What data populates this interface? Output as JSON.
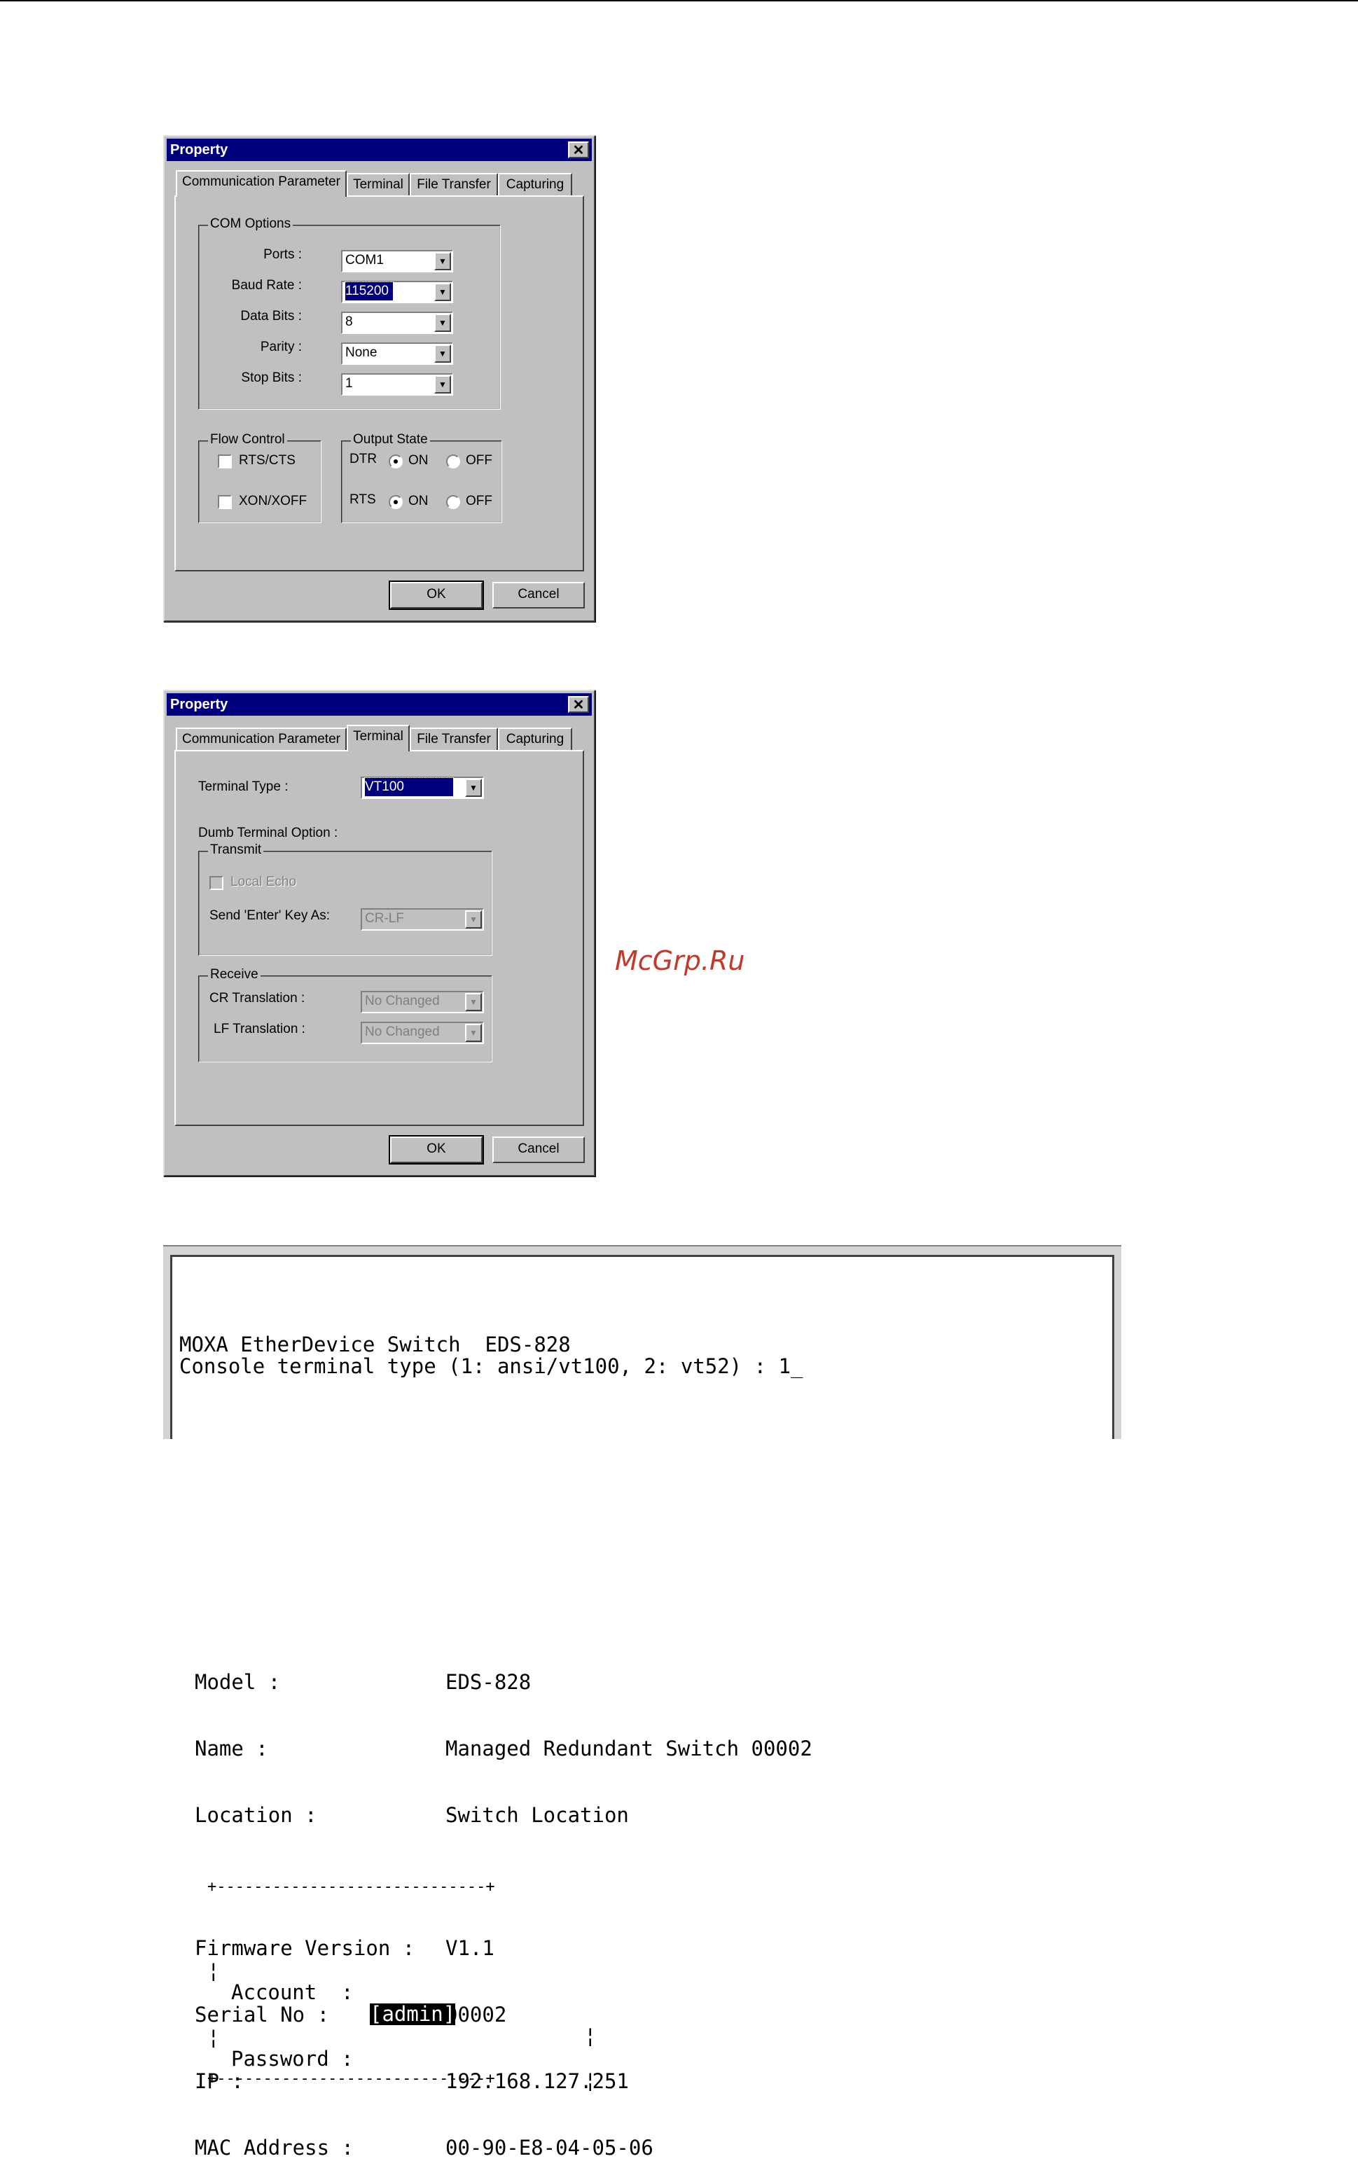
{
  "dialog1": {
    "title": "Property",
    "close_glyph": "✕",
    "tabs": [
      "Communication Parameter",
      "Terminal",
      "File Transfer",
      "Capturing"
    ],
    "com_options": {
      "label": "COM Options",
      "ports_label": "Ports :",
      "ports_value": "COM1",
      "baud_label": "Baud Rate :",
      "baud_value": "115200",
      "databits_label": "Data Bits :",
      "databits_value": "8",
      "parity_label": "Parity :",
      "parity_value": "None",
      "stopbits_label": "Stop Bits :",
      "stopbits_value": "1"
    },
    "flow_control": {
      "label": "Flow Control",
      "rts_cts": "RTS/CTS",
      "xon_xoff": "XON/XOFF"
    },
    "output_state": {
      "label": "Output State",
      "dtr": "DTR",
      "rts": "RTS",
      "on": "ON",
      "off": "OFF"
    },
    "ok": "OK",
    "cancel": "Cancel"
  },
  "dialog2": {
    "title": "Property",
    "close_glyph": "✕",
    "tabs": [
      "Communication Parameter",
      "Terminal",
      "File Transfer",
      "Capturing"
    ],
    "terminal_type_label": "Terminal Type :",
    "terminal_type_value": "VT100",
    "dumb_option_label": "Dumb Terminal Option :",
    "transmit_label": "Transmit",
    "local_echo": "Local Echo",
    "send_enter_label": "Send 'Enter' Key As:",
    "send_enter_value": "CR-LF",
    "receive_label": "Receive",
    "cr_label": "CR Translation :",
    "cr_value": "No Changed",
    "lf_label": "LF Translation :",
    "lf_value": "No Changed",
    "ok": "OK",
    "cancel": "Cancel"
  },
  "watermark": "McGrp.Ru",
  "terminal": {
    "line1": "MOXA EtherDevice Switch  EDS-828",
    "line2": "Console terminal type (1: ansi/vt100, 2: vt52) : 1_"
  },
  "info": [
    {
      "key": "Model :",
      "value": "EDS-828"
    },
    {
      "key": "Name :",
      "value": "Managed Redundant Switch 00002"
    },
    {
      "key": "Location :",
      "value": "Switch Location"
    },
    {
      "key": "",
      "value": ""
    },
    {
      "key": "Firmware Version :",
      "value": "V1.1"
    },
    {
      "key": "Serial No :",
      "value": "00002"
    },
    {
      "key": "IP :",
      "value": "192.168.127.251"
    },
    {
      "key": "MAC Address :",
      "value": "00-90-E8-04-05-06"
    }
  ],
  "login": {
    "border_line": "+-----------------------------+",
    "account_label": "Account  :",
    "account_value": "[admin]",
    "password_label": "Password :"
  },
  "arrow_glyph": "▼"
}
